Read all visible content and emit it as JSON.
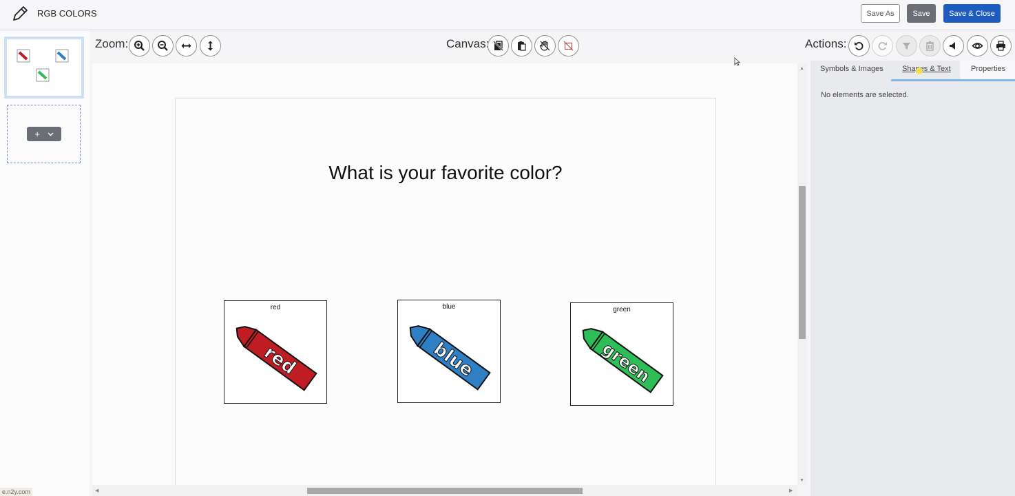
{
  "header": {
    "title": "RGB COLORS",
    "save_as": "Save As",
    "save": "Save",
    "save_close": "Save & Close"
  },
  "toolbar": {
    "zoom_label": "Zoom:",
    "canvas_label": "Canvas:",
    "actions_label": "Actions:"
  },
  "pages": {
    "add_symbol": "+",
    "url": "e.n2y.com"
  },
  "canvas": {
    "question": "What is your favorite color?",
    "cards": [
      {
        "label": "red",
        "crayon_text": "red",
        "color": "#c01c24",
        "dark": "#7d1015"
      },
      {
        "label": "blue",
        "crayon_text": "blue",
        "color": "#2e7fc4",
        "dark": "#1b5185"
      },
      {
        "label": "green",
        "crayon_text": "green",
        "color": "#2fbd57",
        "dark": "#1a7a35"
      }
    ]
  },
  "right_panel": {
    "tabs": [
      "Symbols & Images",
      "Shapes & Text",
      "Properties"
    ],
    "message": "No elements are selected."
  },
  "colors": {
    "primary": "#1e5bbf",
    "secondary": "#6b6e75",
    "tab_accent": "#7fb8e8"
  }
}
